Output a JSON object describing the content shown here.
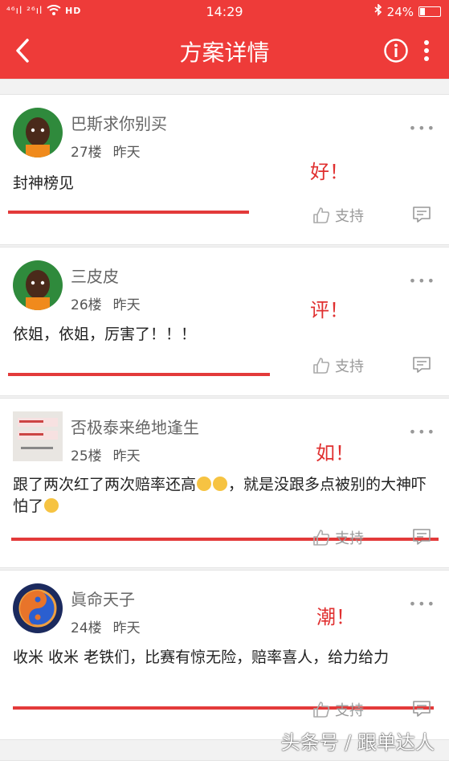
{
  "status_bar": {
    "signal": "⁴⁶ıl ²⁶ıl",
    "hd": "HD",
    "time": "14:29",
    "battery": "24%"
  },
  "nav": {
    "title": "方案详情",
    "back_icon": "chevron-left-icon",
    "info_icon": "info-icon",
    "more_icon": "more-vertical-icon"
  },
  "comments": [
    {
      "user": "巴斯求你别买",
      "floor": "27楼",
      "time": "昨天",
      "content": "封神榜见",
      "note": "好！",
      "support": "支持"
    },
    {
      "user": "三皮皮",
      "floor": "26楼",
      "time": "昨天",
      "content": "依姐，依姐，厉害了！！！",
      "note": "评！",
      "support": "支持"
    },
    {
      "user": "否极泰来绝地逢生",
      "floor": "25楼",
      "time": "昨天",
      "content_part1": "跟了两次红了两次赔率还高",
      "content_part2": "，就是没跟多点被别的大神吓怕了",
      "note": "如！",
      "support": "支持"
    },
    {
      "user": "眞命天子",
      "floor": "24楼",
      "time": "昨天",
      "content": "收米 收米 老铁们，比赛有惊无险，赔率喜人，给力给力",
      "note": "潮！",
      "support": "支持"
    }
  ],
  "watermark": "头条号 / 跟单达人",
  "colors": {
    "header": "#ee3b39",
    "underline": "#e33a3a",
    "note": "#e03030"
  }
}
